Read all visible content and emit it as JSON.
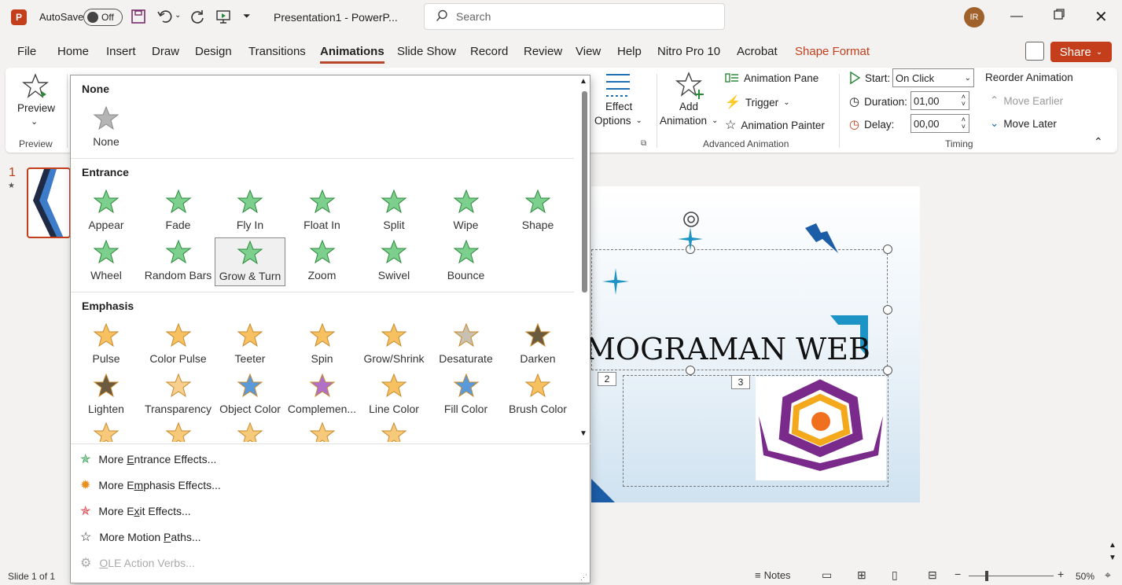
{
  "app": {
    "autosave_label": "AutoSave",
    "autosave_state": "Off",
    "title": "Presentation1  -  PowerP...",
    "search_placeholder": "Search",
    "avatar_initials": "IR",
    "accent": "#c43e1c"
  },
  "menu": {
    "tabs": [
      "File",
      "Home",
      "Insert",
      "Draw",
      "Design",
      "Transitions",
      "Animations",
      "Slide Show",
      "Record",
      "Review",
      "View",
      "Help",
      "Nitro Pro 10",
      "Acrobat",
      "Shape Format"
    ],
    "active": "Animations",
    "share_label": "Share"
  },
  "ribbon": {
    "preview_label": "Preview",
    "preview_group": "Preview",
    "effect_options_1": "Effect",
    "effect_options_2": "Options",
    "add_animation_1": "Add",
    "add_animation_2": "Animation",
    "animation_pane": "Animation Pane",
    "trigger": "Trigger",
    "animation_painter": "Animation Painter",
    "advanced_group": "Advanced Animation",
    "start_label": "Start:",
    "start_value": "On Click",
    "duration_label": "Duration:",
    "duration_value": "01,00",
    "delay_label": "Delay:",
    "delay_value": "00,00",
    "timing_group": "Timing",
    "reorder_label": "Reorder Animation",
    "move_earlier": "Move Earlier",
    "move_later": "Move Later"
  },
  "thumbs": {
    "number": "1"
  },
  "slide": {
    "title": "MOGRAMAN WEB",
    "tag2": "2",
    "tag3": "3"
  },
  "gallery": {
    "none_section": "None",
    "none_label": "None",
    "entrance_section": "Entrance",
    "entrance": [
      "Appear",
      "Fade",
      "Fly In",
      "Float In",
      "Split",
      "Wipe",
      "Shape",
      "Wheel",
      "Random Bars",
      "Grow & Turn",
      "Zoom",
      "Swivel",
      "Bounce"
    ],
    "emphasis_section": "Emphasis",
    "emphasis": [
      "Pulse",
      "Color Pulse",
      "Teeter",
      "Spin",
      "Grow/Shrink",
      "Desaturate",
      "Darken",
      "Lighten",
      "Transparency",
      "Object Color",
      "Complemen...",
      "Line Color",
      "Fill Color",
      "Brush Color"
    ],
    "selected": "Grow & Turn",
    "more": {
      "entrance_pre": "More ",
      "entrance_u": "E",
      "entrance_post": "ntrance Effects...",
      "emphasis_pre": "More E",
      "emphasis_u": "m",
      "emphasis_post": "phasis Effects...",
      "exit_pre": "More E",
      "exit_u": "x",
      "exit_post": "it Effects...",
      "motion_pre": "More Motion ",
      "motion_u": "P",
      "motion_post": "aths...",
      "ole_pre": "",
      "ole_u": "O",
      "ole_post": "LE Action Verbs..."
    }
  },
  "status": {
    "slide_info": "Slide 1 of 1",
    "notes": "Notes",
    "zoom": "50%"
  }
}
